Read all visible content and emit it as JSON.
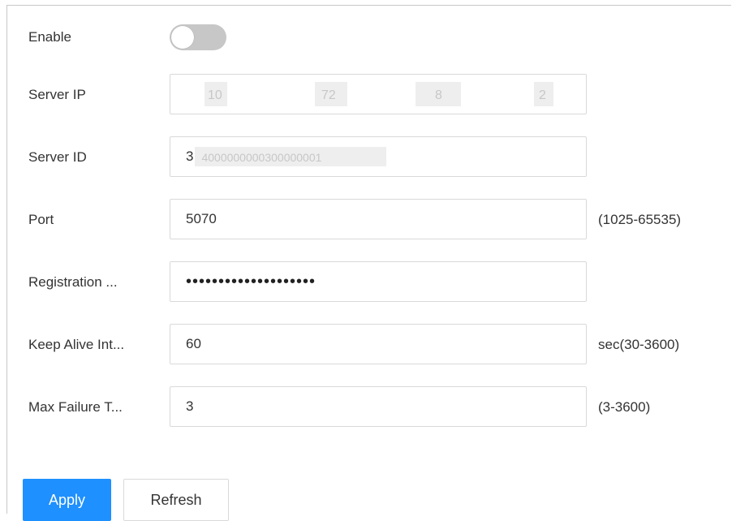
{
  "form": {
    "enable": {
      "label": "Enable",
      "state": "off"
    },
    "server_ip": {
      "label": "Server IP",
      "segments": [
        "10",
        "72",
        "8",
        "2"
      ]
    },
    "server_id": {
      "label": "Server ID",
      "value_prefix": "3",
      "value_blurred": "4000000000300000001"
    },
    "port": {
      "label": "Port",
      "value": "5070",
      "hint": "(1025-65535)"
    },
    "registration_password": {
      "label": "Registration ...",
      "value": "••••••••••••••••••••"
    },
    "keep_alive": {
      "label": "Keep Alive Int...",
      "value": "60",
      "hint": "sec(30-3600)"
    },
    "max_failure": {
      "label": "Max Failure T...",
      "value": "3",
      "hint": "(3-3600)"
    }
  },
  "buttons": {
    "apply_label": "Apply",
    "refresh_label": "Refresh"
  },
  "colors": {
    "primary": "#1e90ff",
    "toggle_off": "#c7c7c7",
    "border": "#d9d9d9"
  }
}
